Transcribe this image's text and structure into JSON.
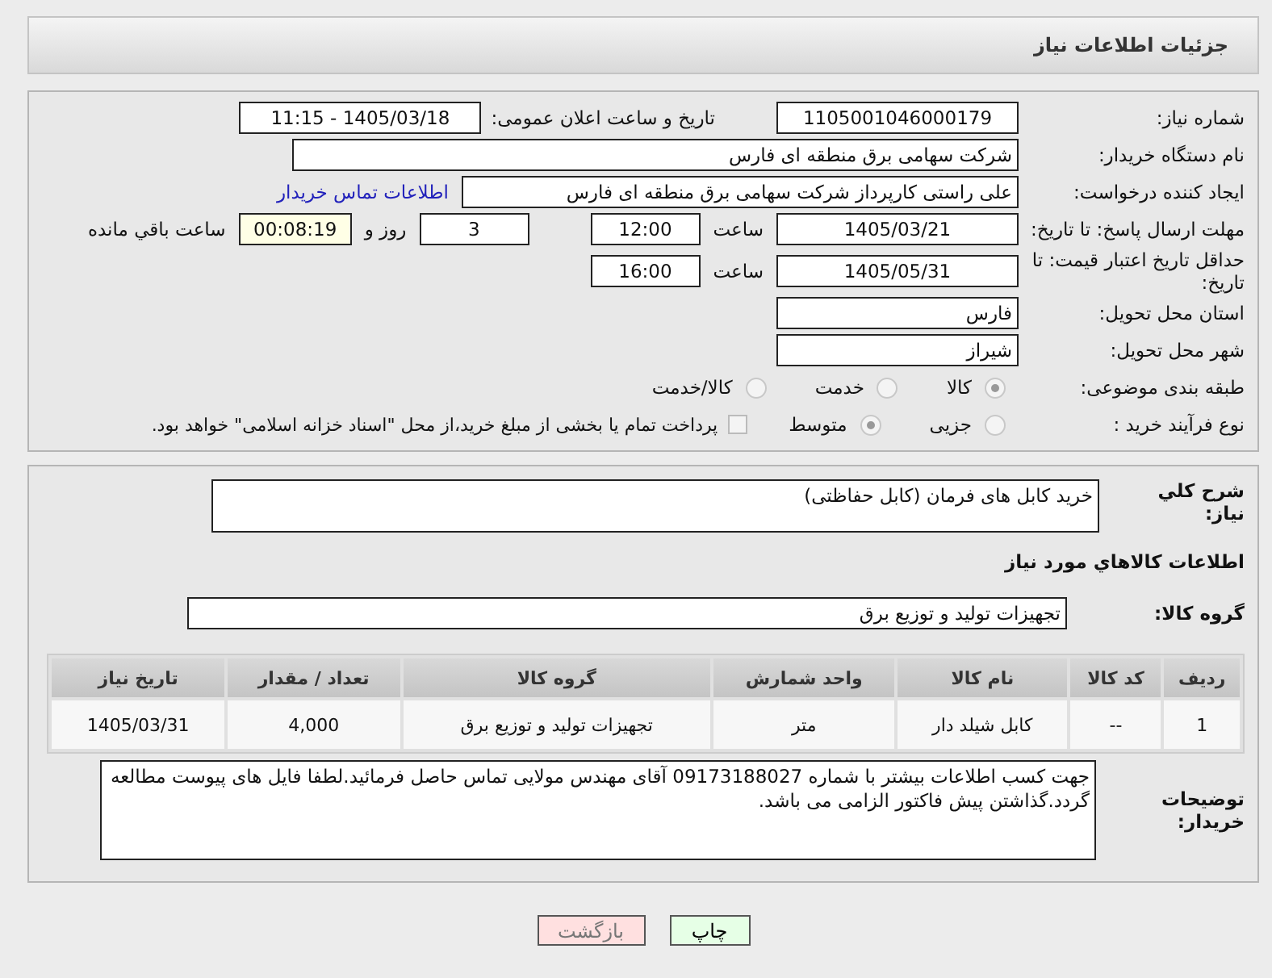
{
  "header": {
    "title": "جزئیات اطلاعات نیاز"
  },
  "need_number": {
    "label": "شماره نیاز:",
    "value": "1105001046000179"
  },
  "announce": {
    "label": "تاریخ و ساعت اعلان عمومی:",
    "value": "1405/03/18 - 11:15"
  },
  "buyer_org": {
    "label": "نام دستگاه خریدار:",
    "value": "شرکت سهامی برق منطقه ای فارس"
  },
  "requester": {
    "label": "ایجاد کننده درخواست:",
    "value": "علی راستی کارپرداز شرکت سهامی برق منطقه ای فارس",
    "link": "اطلاعات تماس خریدار"
  },
  "reply_deadline": {
    "label": "مهلت ارسال پاسخ: تا تاریخ:",
    "date": "1405/03/21",
    "time_label": "ساعت",
    "time": "12:00",
    "days": "3",
    "days_label": "روز و",
    "remaining": "00:08:19",
    "remaining_label": "ساعت باقي مانده"
  },
  "price_validity": {
    "label": "حداقل تاریخ اعتبار قیمت: تا تاریخ:",
    "date": "1405/05/31",
    "time_label": "ساعت",
    "time": "16:00"
  },
  "province": {
    "label": "استان محل تحویل:",
    "value": "فارس"
  },
  "city": {
    "label": "شهر محل تحویل:",
    "value": "شیراز"
  },
  "category": {
    "label": "طبقه بندی موضوعی:",
    "disabled": true,
    "options": [
      {
        "label": "کالا",
        "selected": true
      },
      {
        "label": "خدمت",
        "selected": false
      },
      {
        "label": "کالا/خدمت",
        "selected": false
      }
    ]
  },
  "process": {
    "label": "نوع فرآیند خرید :",
    "disabled": true,
    "options": [
      {
        "label": "جزیی",
        "selected": false
      },
      {
        "label": "متوسط",
        "selected": true
      }
    ],
    "treasury": {
      "checked": false,
      "label": "پرداخت تمام یا بخشی از مبلغ خرید،از محل \"اسناد خزانه اسلامی\" خواهد بود."
    }
  },
  "summary": {
    "label": "شرح کلي نیاز:",
    "value": "خرید کابل های فرمان (کابل حفاظتی)"
  },
  "goods_heading": "اطلاعات کالاهاي مورد نیاز",
  "goods_group": {
    "label": "گروه کالا:",
    "value": "تجهیزات تولید و توزیع برق"
  },
  "table": {
    "columns": [
      "ردیف",
      "کد کالا",
      "نام کالا",
      "واحد شمارش",
      "گروه کالا",
      "تعداد / مقدار",
      "تاریخ نیاز"
    ],
    "rows": [
      [
        "1",
        "--",
        "کابل شیلد دار",
        "متر",
        "تجهیزات تولید و توزیع برق",
        "4,000",
        "1405/03/31"
      ]
    ]
  },
  "buyer_notes": {
    "label": "توضیحات خریدار:",
    "value": "جهت کسب اطلاعات بیشتر با شماره 09173188027 آقای مهندس مولایی تماس حاصل فرمائید.لطفا فایل های پیوست مطالعه گردد.گذاشتن پیش فاکتور الزامی می باشد."
  },
  "buttons": [
    {
      "label": "چاپ",
      "kind": "print"
    },
    {
      "label": "بازگشت",
      "kind": "back"
    }
  ]
}
